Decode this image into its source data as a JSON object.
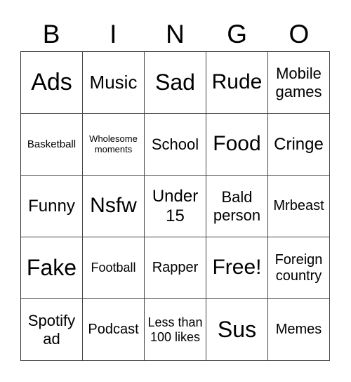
{
  "header": [
    "B",
    "I",
    "N",
    "G",
    "O"
  ],
  "rows": [
    [
      "Ads",
      "Music",
      "Sad",
      "Rude",
      "Mobile games"
    ],
    [
      "Basketball",
      "Wholesome moments",
      "School",
      "Food",
      "Cringe"
    ],
    [
      "Funny",
      "Nsfw",
      "Under 15",
      "Bald person",
      "Mrbeast"
    ],
    [
      "Fake",
      "Football",
      "Rapper",
      "Free!",
      "Foreign country"
    ],
    [
      "Spotify ad",
      "Podcast",
      "Less than 100 likes",
      "Sus",
      "Memes"
    ]
  ]
}
